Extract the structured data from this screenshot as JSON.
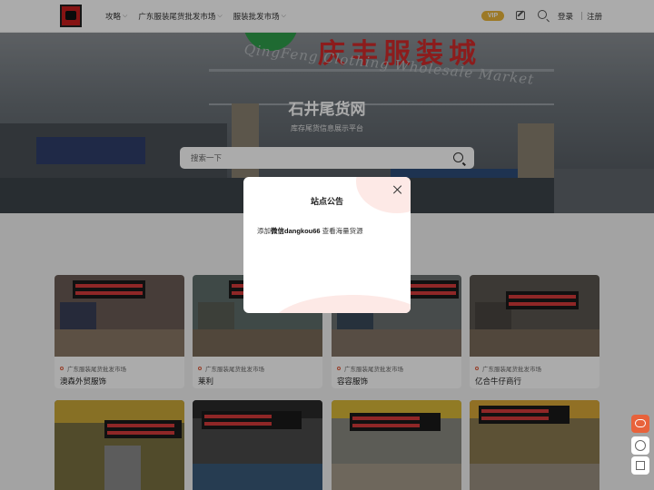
{
  "header": {
    "nav": [
      {
        "label": "攻略"
      },
      {
        "label": "广东服装尾货批发市场"
      },
      {
        "label": "服装批发市场"
      }
    ],
    "vip_label": "VIP",
    "login_label": "登录",
    "register_label": "注册"
  },
  "hero": {
    "title": "石井尾货网",
    "subtitle": "库存尾货信息展示平台",
    "search_placeholder": "搜索一下"
  },
  "cards": [
    {
      "category": "广东服装尾货批发市场",
      "name": "澳森外贸服饰"
    },
    {
      "category": "广东服装尾货批发市场",
      "name": "莱利"
    },
    {
      "category": "广东服装尾货批发市场",
      "name": "容容服饰"
    },
    {
      "category": "广东服装尾货批发市场",
      "name": "亿合牛仔商行"
    }
  ],
  "modal": {
    "title": "站点公告",
    "text_prefix": "添加",
    "text_bold": "微信dangkou66",
    "text_suffix": " 查看海量货源"
  },
  "colors": {
    "accent": "#e8623b",
    "vip": "#e9b53a"
  }
}
